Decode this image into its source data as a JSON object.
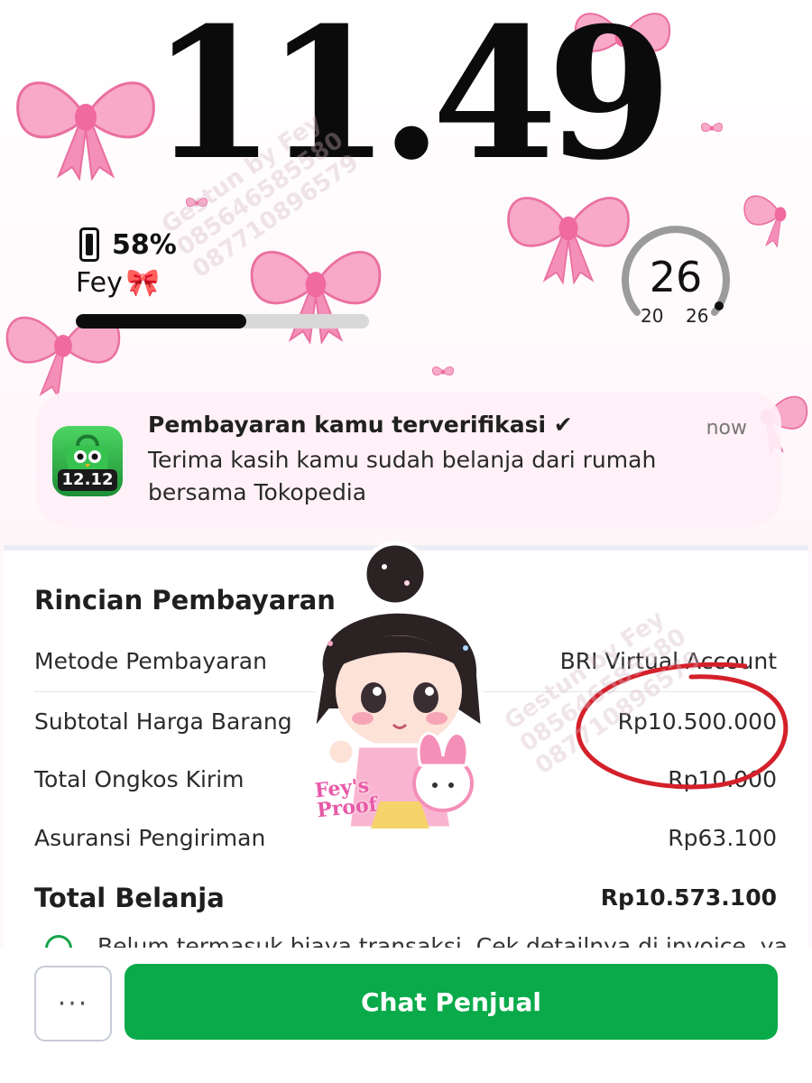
{
  "lockscreen": {
    "time": "11.49",
    "battery_percent": "58%",
    "owner_name": "Fey",
    "owner_emoji": "🎀",
    "progress_fraction": 0.58,
    "gauge": {
      "value": "26",
      "min": "20",
      "max": "26"
    }
  },
  "notification": {
    "app_badge": "12.12",
    "title": "Pembayaran kamu terverifikasi ✔",
    "body": "Terima kasih kamu sudah belanja dari rumah bersama Tokopedia",
    "time": "now"
  },
  "payment": {
    "section_title": "Rincian Pembayaran",
    "rows": [
      {
        "label": "Metode Pembayaran",
        "value": "BRI Virtual Account"
      },
      {
        "label": "Subtotal Harga Barang",
        "value": "Rp10.500.000"
      },
      {
        "label": "Total Ongkos Kirim",
        "value": "Rp10.000"
      },
      {
        "label": "Asuransi Pengiriman",
        "value": "Rp63.100"
      }
    ],
    "total_label": "Total Belanja",
    "total_value": "Rp10.573.100",
    "note": "Belum termasuk biaya transaksi. Cek detailnya di invoice, ya"
  },
  "actions": {
    "more_label": "···",
    "chat_label": "Chat Penjual"
  },
  "sticker": {
    "line1": "Fey's",
    "line2": "Proof"
  },
  "watermark": {
    "line1": "Gestun by Fey",
    "line2": "085646585580",
    "line3": "087710896579"
  },
  "colors": {
    "accent_green": "#0aaa4a",
    "bow_pink": "#f48fb8",
    "circle_red": "#d4202a"
  }
}
